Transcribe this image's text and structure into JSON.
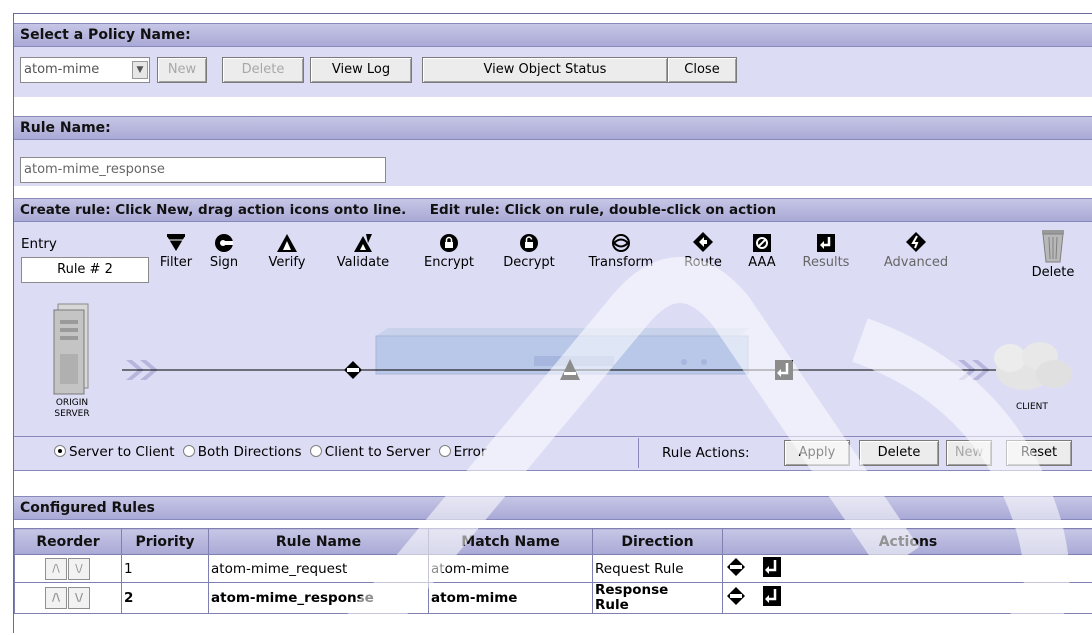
{
  "policy": {
    "header": "Select a Policy Name:",
    "selected": "atom-mime",
    "buttons": {
      "new": "New",
      "delete": "Delete",
      "view_log": "View Log",
      "view_status": "View Object Status",
      "close": "Close"
    }
  },
  "rule": {
    "header": "Rule Name:",
    "name_value": "atom-mime_response"
  },
  "create": {
    "header": "Create rule: Click New, drag action icons onto line.     Edit rule: Click on rule, double-click on action",
    "entry_label": "Entry",
    "entry_value": "Rule # 2",
    "tools": [
      "Filter",
      "Sign",
      "Verify",
      "Validate",
      "Encrypt",
      "Decrypt",
      "Transform",
      "Route",
      "AAA",
      "Results",
      "Advanced"
    ],
    "delete_label": "Delete",
    "origin_label_1": "ORIGIN",
    "origin_label_2": "SERVER",
    "client_label": "CLIENT",
    "directions": [
      "Server to Client",
      "Both Directions",
      "Client to Server",
      "Error"
    ],
    "selected_direction": "Server to Client",
    "rule_actions_label": "Rule Actions:",
    "action_buttons": {
      "apply": "Apply",
      "delete": "Delete",
      "new": "New",
      "reset": "Reset"
    }
  },
  "configured": {
    "header": "Configured Rules",
    "columns": [
      "Reorder",
      "Priority",
      "Rule Name",
      "Match Name",
      "Direction",
      "Actions"
    ],
    "rows": [
      {
        "priority": "1",
        "rule_name": "atom-mime_request",
        "match_name": "atom-mime",
        "direction": "Request Rule"
      },
      {
        "priority": "2",
        "rule_name": "atom-mime_response",
        "match_name": "atom-mime",
        "direction_1": "Response",
        "direction_2": "Rule"
      }
    ]
  }
}
